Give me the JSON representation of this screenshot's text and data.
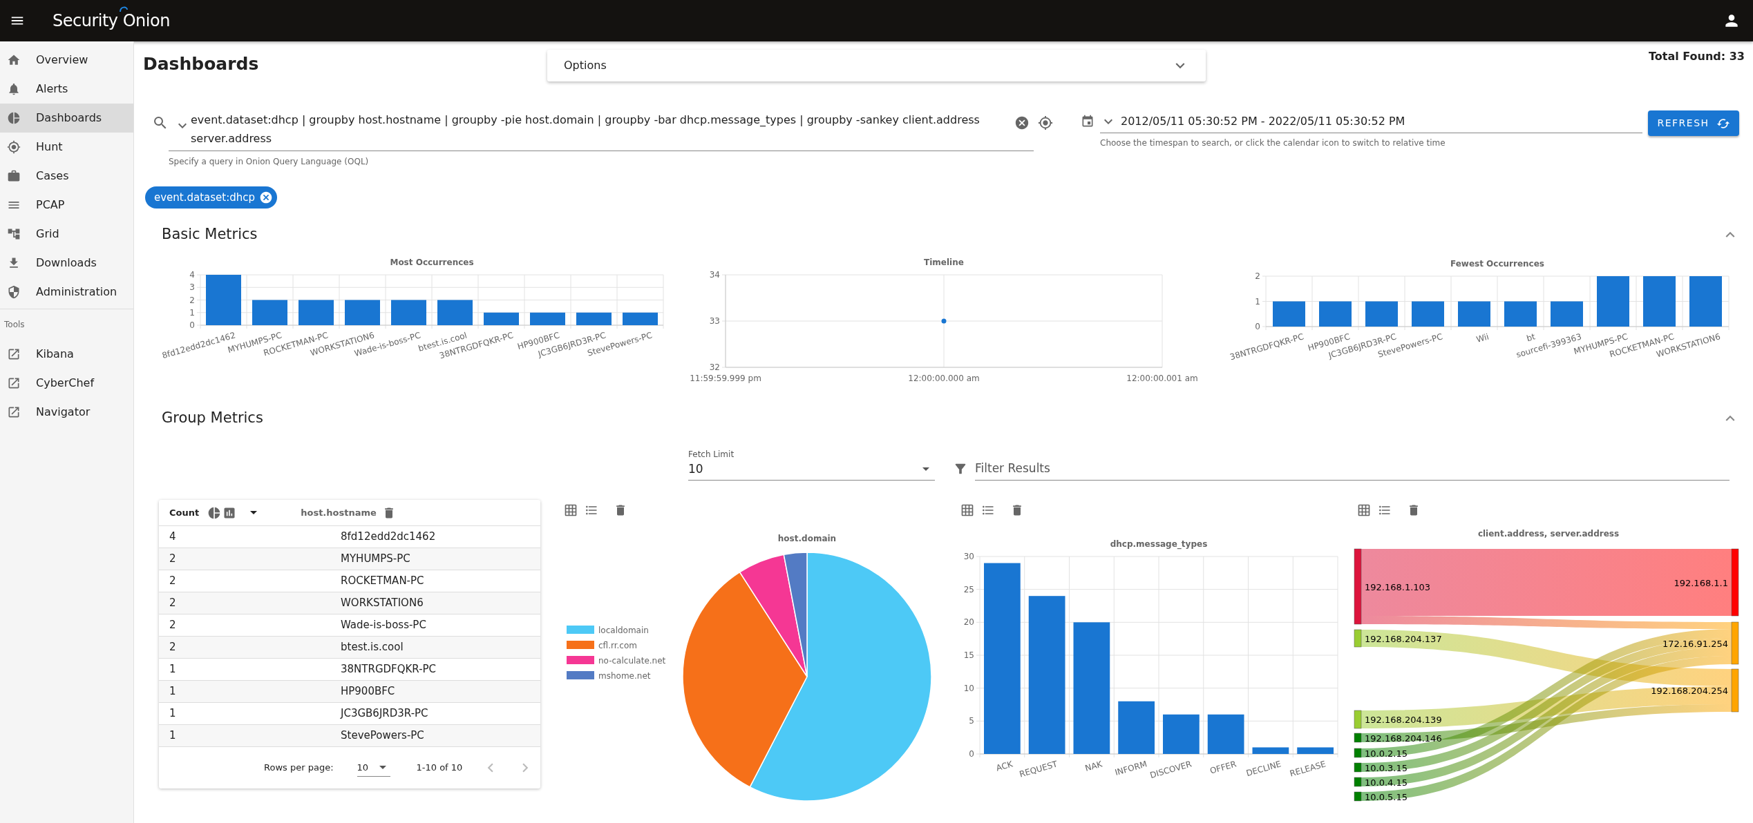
{
  "header": {
    "logo": "Security Onion"
  },
  "sidebar": {
    "items": [
      {
        "label": "Overview",
        "selected": false
      },
      {
        "label": "Alerts",
        "selected": false
      },
      {
        "label": "Dashboards",
        "selected": true
      },
      {
        "label": "Hunt",
        "selected": false
      },
      {
        "label": "Cases",
        "selected": false
      },
      {
        "label": "PCAP",
        "selected": false
      },
      {
        "label": "Grid",
        "selected": false
      },
      {
        "label": "Downloads",
        "selected": false
      },
      {
        "label": "Administration",
        "selected": false
      }
    ],
    "tools_heading": "Tools",
    "tools": [
      {
        "label": "Kibana"
      },
      {
        "label": "CyberChef"
      },
      {
        "label": "Navigator"
      }
    ]
  },
  "page": {
    "title": "Dashboards",
    "options_label": "Options",
    "total_found": "Total Found: 33"
  },
  "query": {
    "value": "event.dataset:dhcp | groupby host.hostname | groupby -pie host.domain | groupby -bar dhcp.message_types | groupby -sankey client.address server.address",
    "hint": "Specify a query in Onion Query Language (OQL)"
  },
  "date_range": {
    "value": "2012/05/11 05:30:52 PM - 2022/05/11 05:30:52 PM",
    "hint": "Choose the timespan to search, or click the calendar icon to switch to relative time"
  },
  "refresh_button": "REFRESH",
  "filter_chips": [
    {
      "label": "event.dataset:dhcp"
    }
  ],
  "basic_metrics": {
    "heading": "Basic Metrics",
    "charts": [
      {
        "chart_data": {
          "type": "bar",
          "title": "Most Occurrences",
          "categories": [
            "8fd12edd2dc1462",
            "MYHUMPS-PC",
            "ROCKETMAN-PC",
            "WORKSTATION6",
            "Wade-is-boss-PC",
            "btest.is.cool",
            "38NTRGDFQKR-PC",
            "HP900BFC",
            "JC3GB6JRD3R-PC",
            "StevePowers-PC"
          ],
          "values": [
            4,
            2,
            2,
            2,
            2,
            2,
            1,
            1,
            1,
            1
          ],
          "ylim": [
            0,
            4
          ],
          "yticks": [
            0,
            1,
            2,
            3,
            4
          ],
          "grid": true
        }
      },
      {
        "chart_data": {
          "type": "scatter",
          "title": "Timeline",
          "categories": [
            "11:59:59.999 pm",
            "12:00:00.000 am",
            "12:00:00.001 am"
          ],
          "values": [
            null,
            33,
            null
          ],
          "ylim": [
            32,
            34
          ],
          "yticks": [
            32,
            33,
            34
          ],
          "grid": true
        }
      },
      {
        "chart_data": {
          "type": "bar",
          "title": "Fewest Occurrences",
          "categories": [
            "38NTRGDFQKR-PC",
            "HP900BFC",
            "JC3GB6JRD3R-PC",
            "StevePowers-PC",
            "Wii",
            "bt",
            "sourcefi-399363",
            "MYHUMPS-PC",
            "ROCKETMAN-PC",
            "WORKSTATION6"
          ],
          "values": [
            1,
            1,
            1,
            1,
            1,
            1,
            1,
            2,
            2,
            2
          ],
          "ylim": [
            0,
            2
          ],
          "yticks": [
            0,
            1,
            2
          ],
          "grid": true
        }
      }
    ]
  },
  "group_metrics": {
    "heading": "Group Metrics",
    "fetch_limit": {
      "label": "Fetch Limit",
      "value": "10"
    },
    "filter": {
      "placeholder": "Filter Results"
    },
    "table": {
      "columns": [
        "Count",
        "host.hostname"
      ],
      "rows": [
        {
          "count": "4",
          "hostname": "8fd12edd2dc1462"
        },
        {
          "count": "2",
          "hostname": "MYHUMPS-PC"
        },
        {
          "count": "2",
          "hostname": "ROCKETMAN-PC"
        },
        {
          "count": "2",
          "hostname": "WORKSTATION6"
        },
        {
          "count": "2",
          "hostname": "Wade-is-boss-PC"
        },
        {
          "count": "2",
          "hostname": "btest.is.cool"
        },
        {
          "count": "1",
          "hostname": "38NTRGDFQKR-PC"
        },
        {
          "count": "1",
          "hostname": "HP900BFC"
        },
        {
          "count": "1",
          "hostname": "JC3GB6JRD3R-PC"
        },
        {
          "count": "1",
          "hostname": "StevePowers-PC"
        }
      ],
      "rows_per_page_label": "Rows per page:",
      "rows_per_page": "10",
      "range": "1-10 of 10"
    },
    "pie": {
      "chart_data": {
        "type": "pie",
        "title": "host.domain",
        "categories": [
          "localdomain",
          "cfl.rr.com",
          "no-calculate.net",
          "mshome.net"
        ],
        "values": [
          57.6,
          33.3,
          6.1,
          3.0
        ],
        "colors": [
          "#4dc9f6",
          "#f67019",
          "#f53794",
          "#537bc4"
        ],
        "legend": "left"
      }
    },
    "bar": {
      "chart_data": {
        "type": "bar",
        "title": "dhcp.message_types",
        "categories": [
          "ACK",
          "REQUEST",
          "NAK",
          "INFORM",
          "DISCOVER",
          "OFFER",
          "DECLINE",
          "RELEASE"
        ],
        "values": [
          29,
          24,
          20,
          8,
          6,
          6,
          1,
          1
        ],
        "ylim": [
          0,
          30
        ],
        "yticks": [
          0,
          5,
          10,
          15,
          20,
          25,
          30
        ],
        "grid": true
      }
    },
    "sankey": {
      "title": "client.address, server.address",
      "sources": [
        {
          "label": "192.168.1.103",
          "color": "#dc143c"
        },
        {
          "label": "192.168.204.137",
          "color": "#9acd32"
        },
        {
          "label": "192.168.204.139",
          "color": "#9acd32"
        },
        {
          "label": "192.168.204.146",
          "color": "#008000"
        },
        {
          "label": "10.0.2.15",
          "color": "#008000"
        },
        {
          "label": "10.0.3.15",
          "color": "#008000"
        },
        {
          "label": "10.0.4.15",
          "color": "#008000"
        },
        {
          "label": "10.0.5.15",
          "color": "#008000"
        }
      ],
      "targets": [
        {
          "label": "192.168.1.1",
          "color": "#ff0000"
        },
        {
          "label": "172.16.91.254",
          "color": "#ffa500"
        },
        {
          "label": "192.168.204.254",
          "color": "#ffa500"
        }
      ]
    }
  }
}
